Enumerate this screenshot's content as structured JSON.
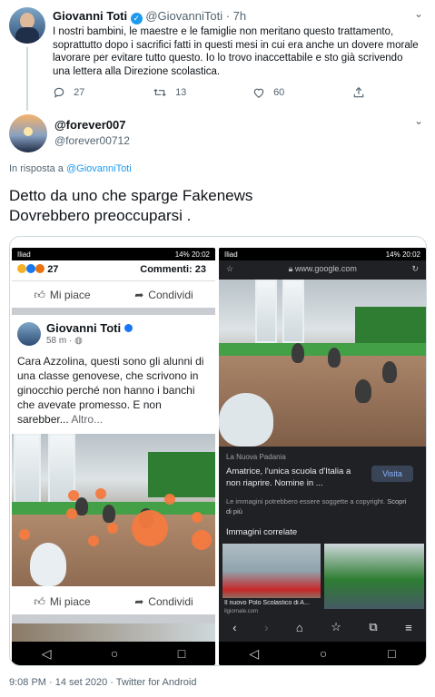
{
  "tweet1": {
    "name": "Giovanni Toti",
    "handle": "@GiovanniToti",
    "time": "· 7h",
    "text": "I nostri bambini, le maestre e le famiglie non meritano questo trattamento, soprattutto dopo i sacrifici fatti in questi mesi in cui era anche un dovere morale lavorare per evitare tutto questo. Io lo trovo inaccettabile e sto già scrivendo una lettera alla Direzione scolastica.",
    "replies": "27",
    "retweets": "13",
    "likes": "60"
  },
  "tweet2": {
    "name": "@forever007",
    "handle": "@forever00712",
    "reply_prefix": "In risposta a",
    "reply_to": "@GiovanniToti",
    "text_line1": "Detto da uno che sparge Fakenews",
    "text_line2": "Dovrebbero preoccuparsi ."
  },
  "left_phone": {
    "status_left": "Iliad",
    "status_right": "14% 20:02",
    "reactions_count": "27",
    "comments": "Commenti: 23",
    "like_label": "Mi piace",
    "share_label": "Condividi",
    "post_author": "Giovanni Toti",
    "post_time": "58 m ·",
    "post_text": "Cara Azzolina, questi sono gli alunni di una classe genovese, che scrivono in ginocchio perché non hanno i banchi che avevate promesso. E non sarebber...",
    "more": "Altro...",
    "like_label2": "Mi piace",
    "share_label2": "Condividi"
  },
  "right_phone": {
    "status_left": "Iliad",
    "status_right": "14% 20:02",
    "url": "www.google.com",
    "source": "La Nuova Padania",
    "headline": "Amatrice, l'unica scuola d'Italia a non riaprire. Nomine in ...",
    "visit": "Visita",
    "copyright": "Le immagini potrebbero essere soggette a copyright.",
    "learn_more": "Scopri di più",
    "related": "Immagini correlate",
    "thumb_caption": "Il nuovo Polo Scolastico di A...",
    "thumb_site": "ilgiornale.com"
  },
  "footer": {
    "timestamp": "9:08 PM · 14 set 2020 · Twitter for Android"
  },
  "colors": {
    "twitter_blue": "#1d9bf0",
    "verified": "#1d9bf0",
    "fb_blue": "#1877f2"
  }
}
